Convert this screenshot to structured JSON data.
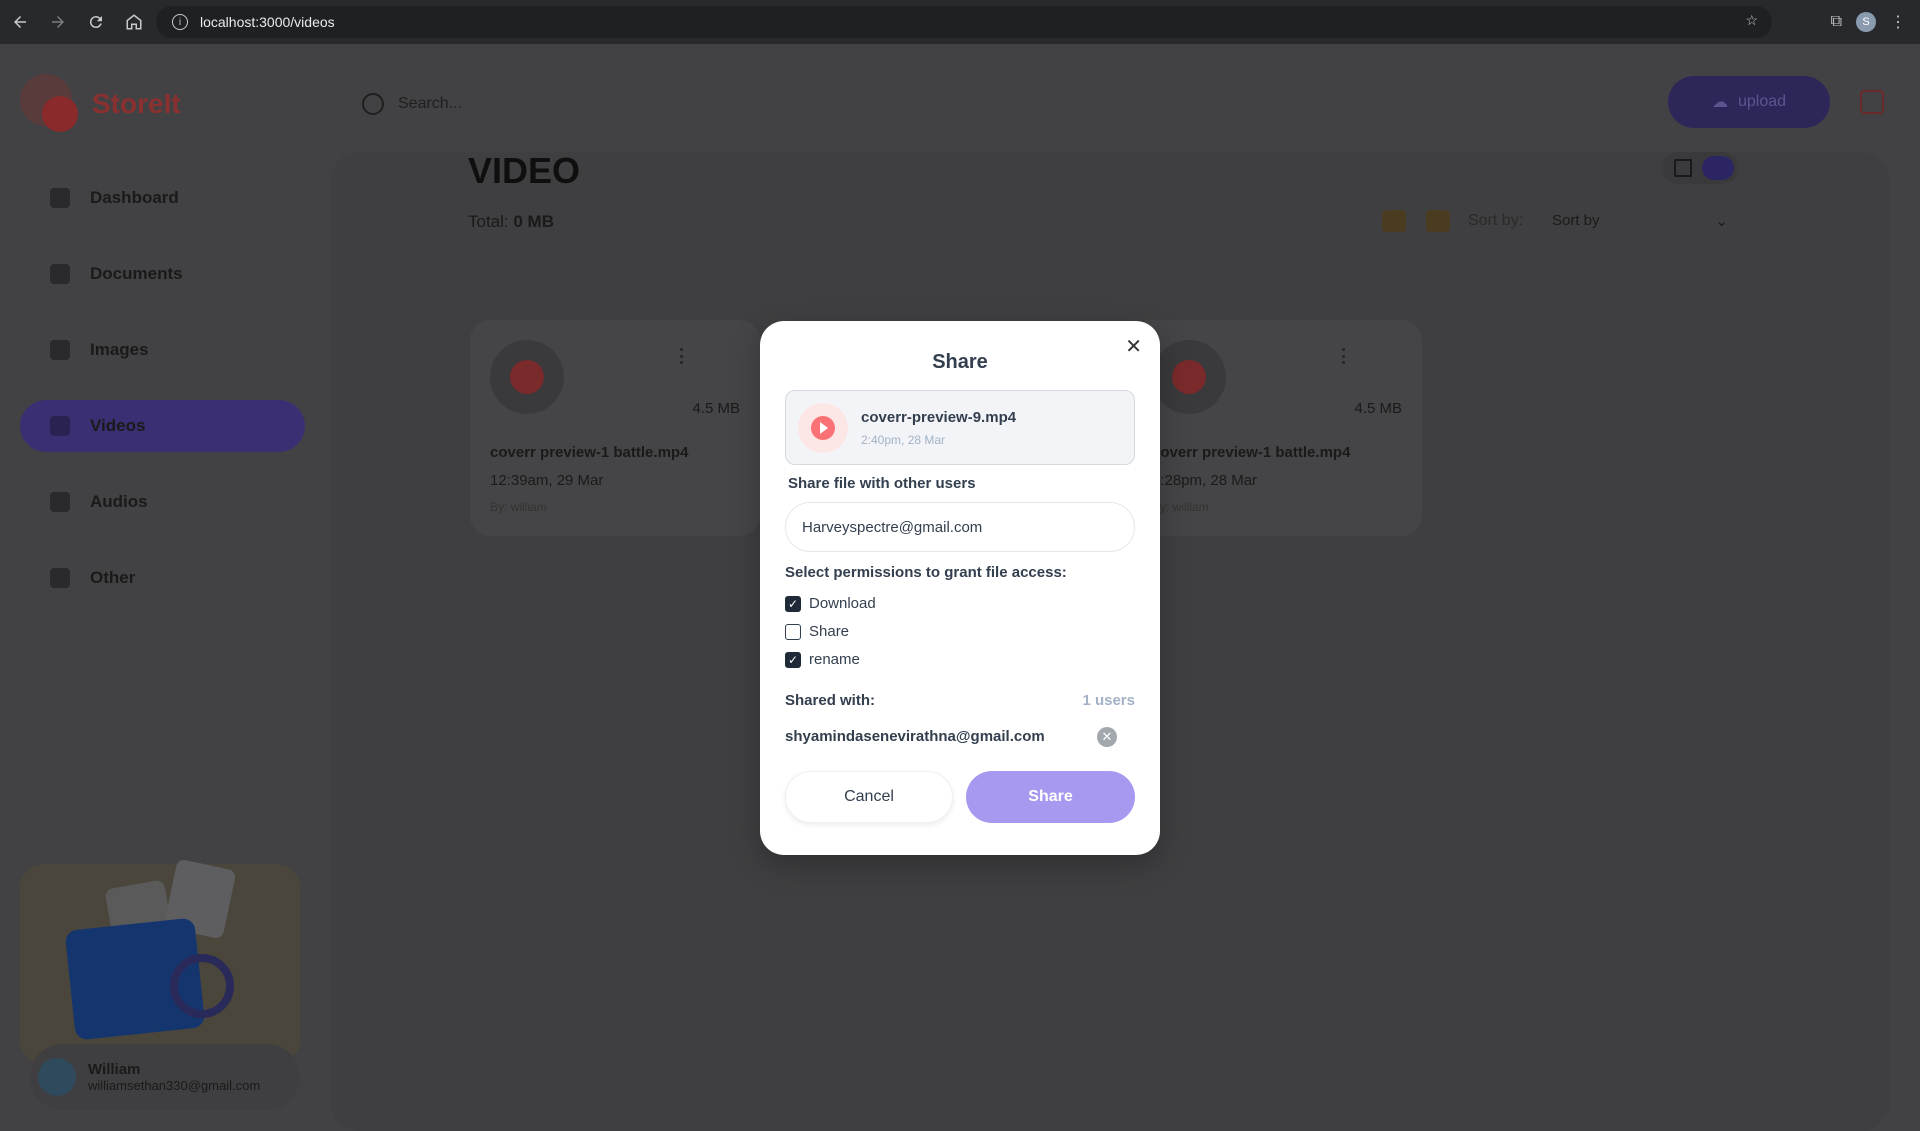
{
  "browser": {
    "url": "localhost:3000/videos",
    "profile_initial": "S"
  },
  "app": {
    "logo_text": "StoreIt",
    "search_placeholder": "Search...",
    "upload_label": "upload",
    "nav": [
      {
        "label": "Dashboard"
      },
      {
        "label": "Documents"
      },
      {
        "label": "Images"
      },
      {
        "label": "Videos"
      },
      {
        "label": "Audios"
      },
      {
        "label": "Other"
      }
    ],
    "user": {
      "name": "William",
      "email": "williamsethan330@gmail.com"
    }
  },
  "main": {
    "title": "VIDEO",
    "total_label": "Total:",
    "total_value": "0 MB",
    "sort_label": "Sort by:",
    "sort_value": "Sort by",
    "cards": [
      {
        "name": "coverr preview-1 battle.mp4",
        "date": "12:39am, 29 Mar",
        "by": "By: william",
        "size": "4.5 MB"
      },
      {
        "name": "coverr preview-1 battle.mp4",
        "date": "2:28pm, 28 Mar",
        "by": "By: william",
        "size": "4.5 MB"
      }
    ]
  },
  "modal": {
    "title": "Share",
    "file_name": "coverr-preview-9.mp4",
    "file_date": "2:40pm, 28 Mar",
    "share_label": "Share file with other users",
    "email_value": "Harveyspectre@gmail.com",
    "permissions_label": "Select permissions to grant file access:",
    "permissions": [
      {
        "label": "Download",
        "checked": true
      },
      {
        "label": "Share",
        "checked": false
      },
      {
        "label": "rename",
        "checked": true
      }
    ],
    "shared_with_label": "Shared with:",
    "shared_count": "1 users",
    "shared_users": [
      "shyamindasenevirathna@gmail.com"
    ],
    "cancel_label": "Cancel",
    "share_button_label": "Share"
  },
  "colors": {
    "accent": "#a798f0",
    "play": "#fa7275",
    "overlay": "#3c3c3f"
  }
}
